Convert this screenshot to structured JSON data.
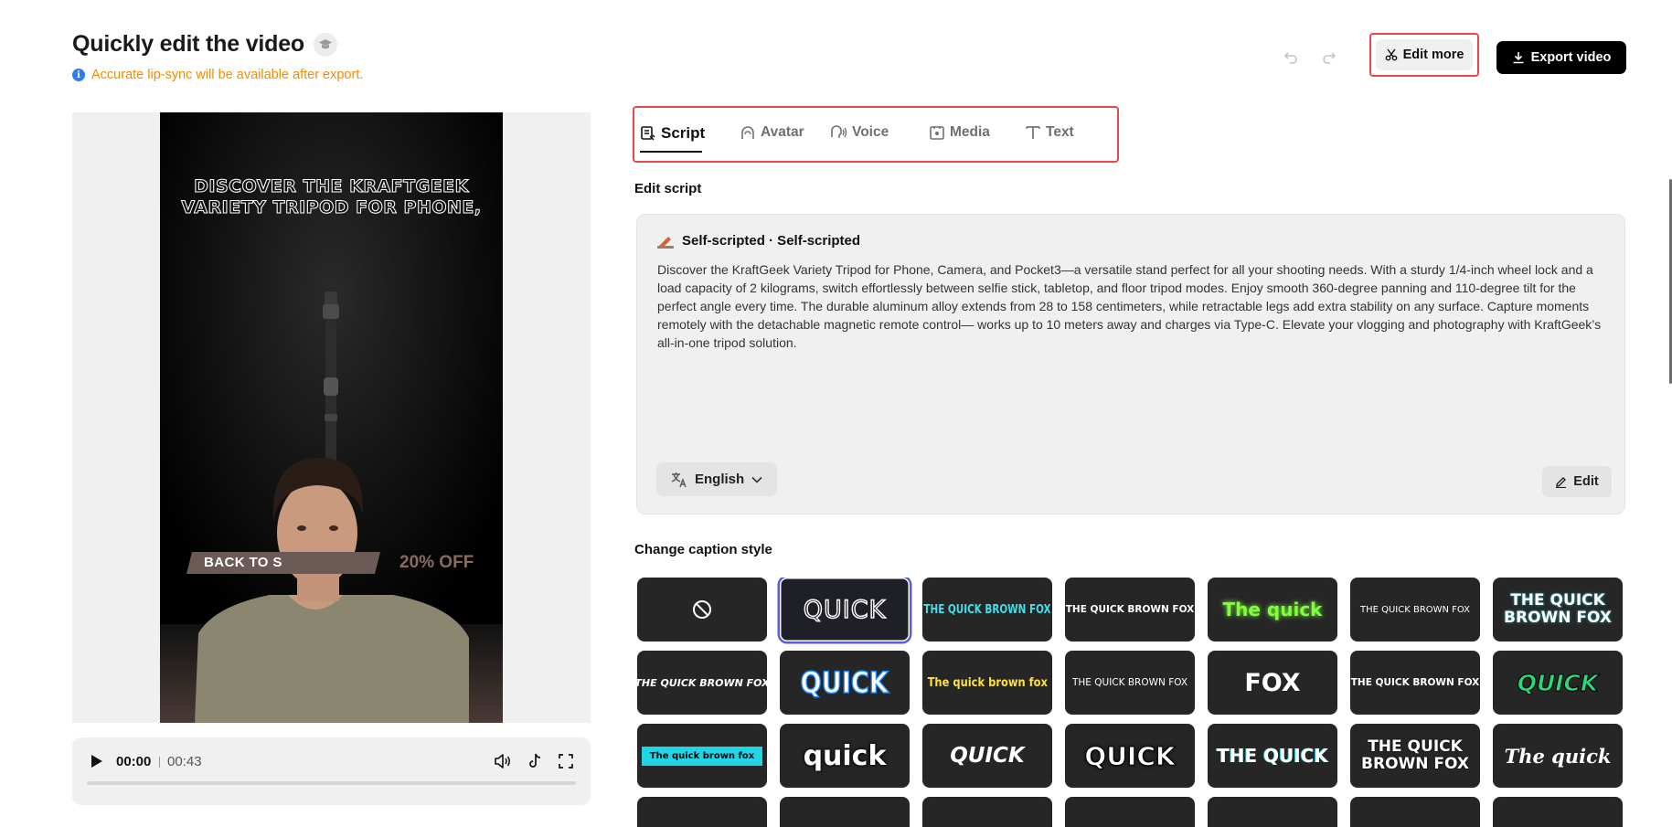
{
  "header": {
    "title": "Quickly edit the video",
    "notice": "Accurate lip-sync will be available after export.",
    "edit_more_label": "Edit more",
    "export_label": "Export video"
  },
  "video": {
    "overlay_title": "DISCOVER THE KRAFTGEEK VARIETY TRIPOD FOR PHONE,",
    "banner_text": "BACK TO S",
    "discount_text": "20% OFF",
    "current_time": "00:00",
    "total_time": "00:43",
    "progress": 0
  },
  "tabs": [
    {
      "label": "Script",
      "icon": "script-icon",
      "active": true
    },
    {
      "label": "Avatar",
      "icon": "avatar-icon",
      "active": false
    },
    {
      "label": "Voice",
      "icon": "voice-icon",
      "active": false
    },
    {
      "label": "Media",
      "icon": "media-icon",
      "active": false
    },
    {
      "label": "Text",
      "icon": "text-icon",
      "active": false
    }
  ],
  "script": {
    "section_label": "Edit script",
    "source": "Self-scripted · Self-scripted",
    "body": "Discover the KraftGeek Variety Tripod for Phone, Camera, and Pocket3—a versatile stand perfect for all your shooting needs. With a sturdy 1/4-inch wheel lock and a load capacity of 2 kilograms, switch effortlessly between selfie stick, tabletop, and floor tripod modes. Enjoy smooth 360-degree panning and 110-degree tilt for the perfect angle every time. The durable aluminum alloy extends from 28 to 158 centimeters, while retractable legs add extra stability on any surface. Capture moments remotely with the detachable magnetic remote control— works up to 10 meters away and charges via Type-C. Elevate your vlogging and photography with KraftGeek’s all-in-one tripod solution.",
    "language": "English",
    "edit_label": "Edit"
  },
  "captions": {
    "section_label": "Change caption style",
    "styles": [
      {
        "text": "",
        "kind": "none"
      },
      {
        "text": "QUICK",
        "kind": "outline-white"
      },
      {
        "text": "THE QUICK BROWN FOX",
        "kind": "cyan-condensed"
      },
      {
        "text": "THE QUICK BROWN FOX",
        "kind": "white-cyan-box"
      },
      {
        "text": "The quick",
        "kind": "green-glow"
      },
      {
        "text": "THE QUICK BROWN FOX",
        "kind": "white-small-box"
      },
      {
        "text": "THE QUICK BROWN FOX",
        "kind": "white-teal-outline"
      },
      {
        "text": "THE QUICK BROWN FOX",
        "kind": "cyan-italic-mixed"
      },
      {
        "text": "QUICK",
        "kind": "blue-outline-big"
      },
      {
        "text": "The quick brown fox",
        "kind": "yellow-mixed"
      },
      {
        "text": "THE QUICK BROWN FOX",
        "kind": "teal-box-small"
      },
      {
        "text": "FOX",
        "kind": "white-dark-box"
      },
      {
        "text": "THE QUICK BROWN FOX",
        "kind": "white-blue-word"
      },
      {
        "text": "QUICK",
        "kind": "green-black-outline"
      },
      {
        "text": "The quick brown fox",
        "kind": "cyan-bg-black"
      },
      {
        "text": "quick",
        "kind": "white-black-outline"
      },
      {
        "text": "QUICK",
        "kind": "white-italic-outline"
      },
      {
        "text": "QUICK",
        "kind": "white-thick-outline"
      },
      {
        "text": "THE QUICK",
        "kind": "cyan-white-mixed"
      },
      {
        "text": "THE QUICK BROWN FOX",
        "kind": "white-green-stack"
      },
      {
        "text": "The quick",
        "kind": "white-serif-italic"
      }
    ]
  },
  "colors": {
    "accent_red": "#e5484d",
    "notice_orange": "#f08c00",
    "info_blue": "#2f7cf6",
    "selected_outline": "#5b5fd6"
  }
}
